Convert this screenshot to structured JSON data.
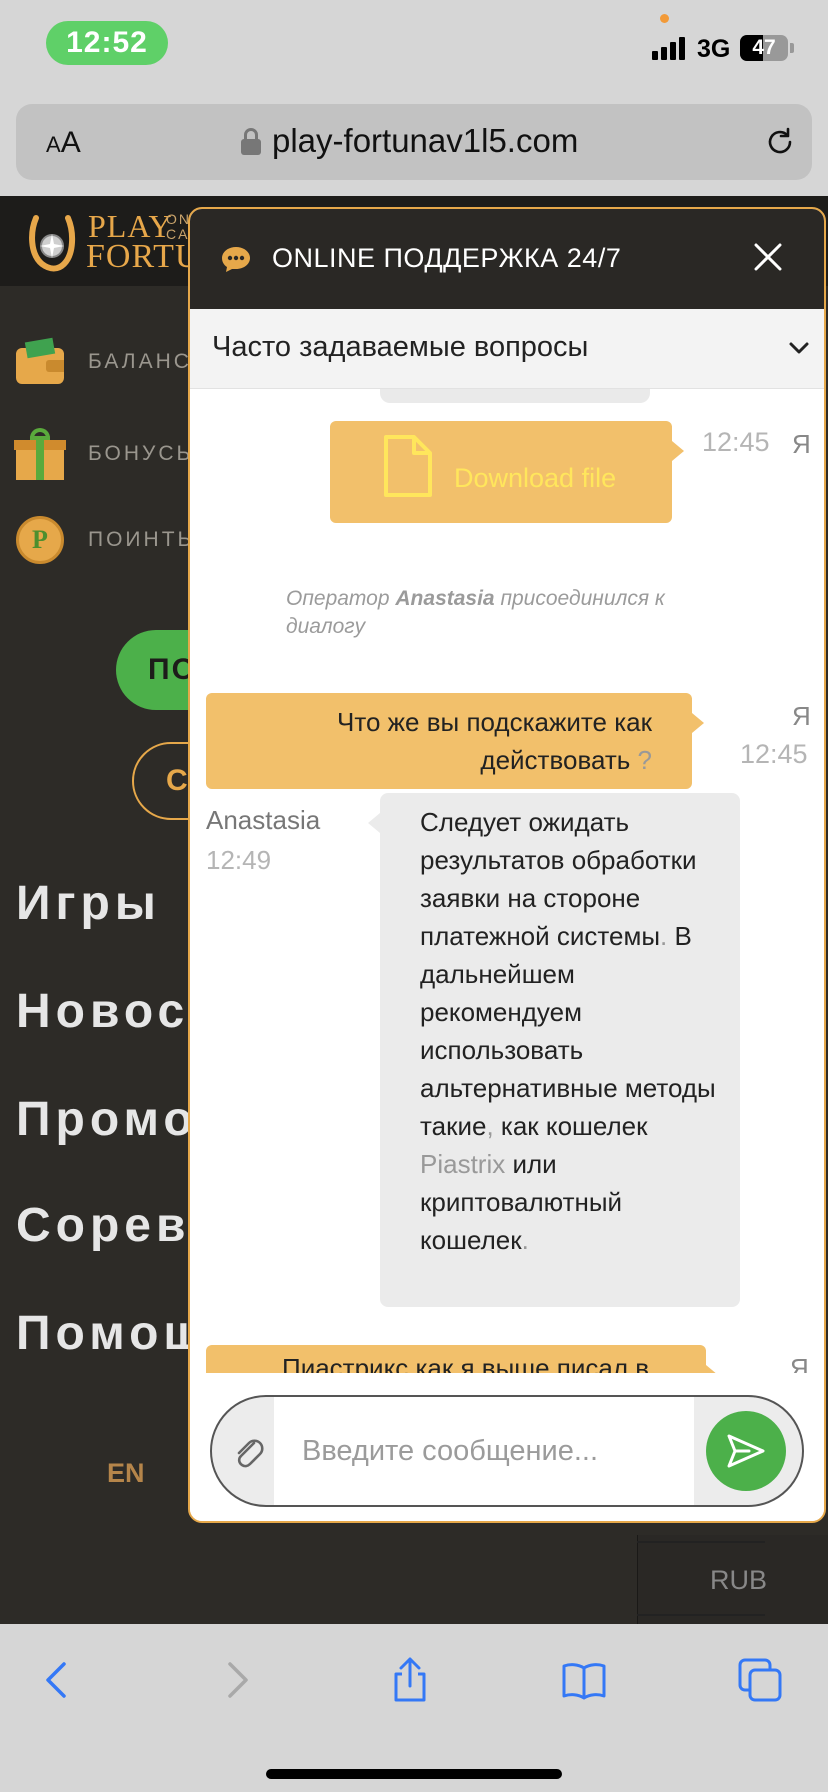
{
  "status_bar": {
    "time": "12:52",
    "network": "3G",
    "battery": "47",
    "battery_level": 0.47
  },
  "browser": {
    "text_size": {
      "small": "A",
      "big": "A"
    },
    "url": "play-fortunav1l5.com"
  },
  "site": {
    "logo": {
      "line1": "PLAY",
      "line2": "FORTU",
      "tag1": "ON",
      "tag2": "CA"
    },
    "side_menu": [
      {
        "label": "БАЛАНС",
        "icon": "wallet-icon"
      },
      {
        "label": "БОНУСЫ",
        "icon": "gift-icon"
      },
      {
        "label": "ПОИНТЫ",
        "icon": "points-coin-icon"
      }
    ],
    "green_button": "ПО",
    "outline_button": "С",
    "nav": [
      "Игры",
      "Новост",
      "Промо",
      "Сорев",
      "Помощ"
    ],
    "language": "EN",
    "currency": "RUB"
  },
  "chat": {
    "title": "ONLINE ПОДДЕРЖКА 24/7",
    "faq_label": "Часто задаваемые вопросы",
    "messages": {
      "file": {
        "label": "Download file",
        "time": "12:45",
        "sender": "Я"
      },
      "system": {
        "prefix": "Оператор ",
        "name": "Anastasia",
        "suffix": " присоединился к диалогу"
      },
      "question": {
        "text": "Что же вы подскажите как действовать",
        "mark": " ?",
        "time": "12:45",
        "sender": "Я"
      },
      "answer": {
        "sender": "Anastasia",
        "time": "12:49",
        "part1": "Следует ожидать результатов обработки заявки на стороне платежной системы",
        "dot1": ".",
        "part2": " В дальнейшем рекомендуем использовать альтернативные методы такие",
        "comma": ",",
        "part3": " как кошелек ",
        "brand": "Piastrix",
        "part4": " или криптовалютный кошелек",
        "dot2": "."
      },
      "next": {
        "text": "Пиастрикс как я выше писал в",
        "sender": "Я"
      }
    },
    "input_placeholder": "Введите сообщение..."
  },
  "colors": {
    "accent": "#e6a84a",
    "bubble_me": "#f2c06b",
    "bubble_agent": "#ebebeb",
    "send": "#4cb04a",
    "ios_blue": "#3478f6"
  }
}
